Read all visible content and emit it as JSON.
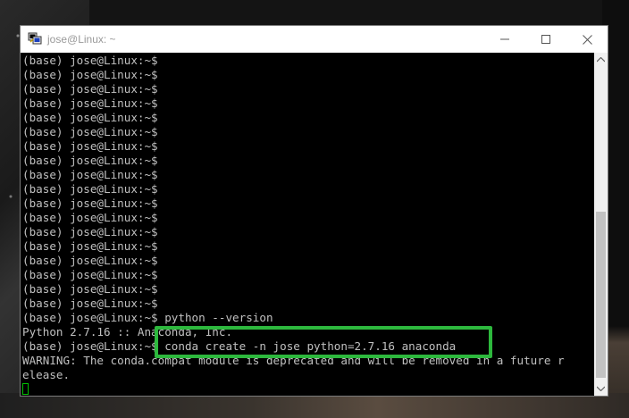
{
  "window": {
    "title": "jose@Linux: ~",
    "icons": {
      "app": "putty-terminal-icon",
      "minimize": "minimize-icon",
      "maximize": "maximize-icon",
      "close": "close-icon"
    }
  },
  "terminal": {
    "lines": [
      "(base) jose@Linux:~$",
      "(base) jose@Linux:~$",
      "(base) jose@Linux:~$",
      "(base) jose@Linux:~$",
      "(base) jose@Linux:~$",
      "(base) jose@Linux:~$",
      "(base) jose@Linux:~$",
      "(base) jose@Linux:~$",
      "(base) jose@Linux:~$",
      "(base) jose@Linux:~$",
      "(base) jose@Linux:~$",
      "(base) jose@Linux:~$",
      "(base) jose@Linux:~$",
      "(base) jose@Linux:~$",
      "(base) jose@Linux:~$",
      "(base) jose@Linux:~$",
      "(base) jose@Linux:~$",
      "(base) jose@Linux:~$",
      "(base) jose@Linux:~$ python --version",
      "Python 2.7.16 :: Anaconda, Inc.",
      "(base) jose@Linux:~$ conda create -n jose python=2.7.16 anaconda",
      "WARNING: The conda.compat module is deprecated and will be removed in a future r",
      "elease."
    ],
    "highlight_color": "#2db83d",
    "text_color": "#c0c0c0",
    "background_color": "#000000"
  }
}
